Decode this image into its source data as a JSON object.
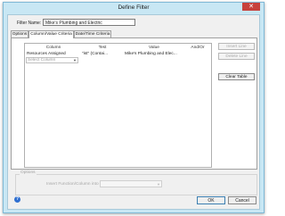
{
  "window": {
    "title": "Define Filter",
    "close_glyph": "✕"
  },
  "filter_name": {
    "label": "Filter Name:",
    "value": "Mike's Plumbing and Electric"
  },
  "tabs": [
    {
      "label": "Options",
      "active": false
    },
    {
      "label": "Column/Value Criteria",
      "active": true
    },
    {
      "label": "Date/Time Criteria",
      "active": false
    }
  ],
  "grid": {
    "headers": [
      "Column",
      "Test",
      "Value",
      "And/Or"
    ],
    "rows": [
      {
        "column": "Resources Assigned",
        "test": "\"ist\" (Contai...",
        "value": "Mike's Plumbing and Elec...",
        "and_or": ""
      }
    ],
    "new_row_placeholder": "Select Column"
  },
  "side_buttons": {
    "insert_line": "Insert Line",
    "delete_line": "Delete Line",
    "clear_table": "Clear Table"
  },
  "options": {
    "legend": "Options",
    "insert_label": "Insert Function/Column into Value",
    "insert_value": ""
  },
  "footer": {
    "help_glyph": "?",
    "ok": "OK",
    "cancel": "Cancel"
  },
  "colors": {
    "window_frame": "#c8e7f4",
    "close_button": "#c7413b",
    "help_icon": "#2f6fd0"
  }
}
